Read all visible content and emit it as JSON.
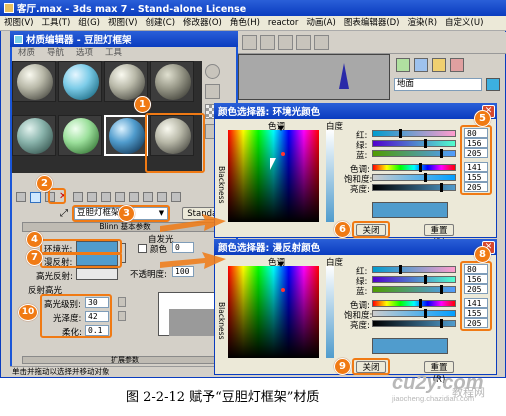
{
  "app_title": "客厅.max - 3ds max 7 - Stand-alone License",
  "menu": [
    "视图(V)",
    "工具(T)",
    "组(G)",
    "视图(V)",
    "创建(C)",
    "修改器(O)",
    "角色(H)",
    "reactor",
    "动画(A)",
    "图表编辑器(D)",
    "渲染(R)",
    "自定义(U)"
  ],
  "right_panel_label": "地面",
  "mat_editor": {
    "title": "材质编辑器 - 豆胆灯框架",
    "menu": [
      "材质",
      "导航",
      "选项",
      "工具"
    ],
    "material_name": "豆胆灯框架",
    "shader_btn": "Standar",
    "rollout_title": "Blinn 基本参数",
    "ambient_label": "环境光:",
    "diffuse_label": "漫反射:",
    "specular_label": "高光反射:",
    "self_illum_group": "自发光",
    "color_label": "颜色",
    "color_value": "0",
    "opacity_label": "不透明度:",
    "opacity_value": "100",
    "spec_group": "反射高光",
    "spec_level_label": "高光级别:",
    "spec_level_value": "30",
    "gloss_label": "光泽度:",
    "gloss_value": "42",
    "soften_label": "柔化:",
    "soften_value": "0.1",
    "expand_label": "扩展参数",
    "status_text": "单击并拖动以选择并移动对象"
  },
  "picker1": {
    "title": "颜色选择器: 环境光颜色",
    "hue_label": "色调",
    "white_label": "白度",
    "black_label": "Blackness",
    "fields": [
      {
        "label": "红:",
        "value": "80"
      },
      {
        "label": "绿:",
        "value": "156"
      },
      {
        "label": "蓝:",
        "value": "205"
      },
      {
        "label": "色调:",
        "value": "141"
      },
      {
        "label": "饱和度:",
        "value": "155"
      },
      {
        "label": "亮度:",
        "value": "205"
      }
    ],
    "close_btn": "关闭",
    "reset_btn": "重置(R)"
  },
  "picker2": {
    "title": "颜色选择器: 漫反射颜色",
    "hue_label": "色调",
    "white_label": "白度",
    "black_label": "Blackness",
    "fields": [
      {
        "label": "红:",
        "value": "80"
      },
      {
        "label": "绿:",
        "value": "156"
      },
      {
        "label": "蓝:",
        "value": "205"
      },
      {
        "label": "色调:",
        "value": "141"
      },
      {
        "label": "饱和度:",
        "value": "155"
      },
      {
        "label": "亮度:",
        "value": "205"
      }
    ],
    "close_btn": "关闭",
    "reset_btn": "重置(R)"
  },
  "markers": [
    "1",
    "2",
    "3",
    "4",
    "5",
    "6",
    "7",
    "8",
    "9",
    "10"
  ],
  "caption": "图 2-2-12   赋予“豆胆灯框架”材质",
  "watermark": "cu2y.com",
  "watermark_sub": "jiaocheng.chazidian.com",
  "watermark_cn": "教程网",
  "colors": {
    "accent": "#f07a14",
    "xp_blue": "#0a3cbf",
    "material_blue": "#509ccd"
  }
}
